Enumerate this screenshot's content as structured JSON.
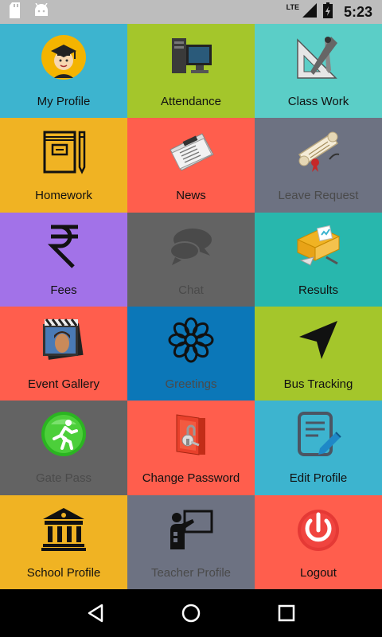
{
  "status_bar": {
    "time": "5:23",
    "network": "LTE",
    "icons": [
      "sd-card-icon",
      "android-icon",
      "signal-icon",
      "battery-icon"
    ]
  },
  "tiles": [
    {
      "label": "My Profile",
      "color": "#3db4cf",
      "icon": "graduate-avatar-icon"
    },
    {
      "label": "Attendance",
      "color": "#a4c62b",
      "icon": "computer-icon"
    },
    {
      "label": "Class Work",
      "color": "#5bcec7",
      "icon": "geometry-tools-icon"
    },
    {
      "label": "Homework",
      "color": "#f0b323",
      "icon": "notebook-icon"
    },
    {
      "label": "News",
      "color": "#ff5e4d",
      "icon": "newspaper-icon"
    },
    {
      "label": "Leave Request",
      "color": "#6d7282",
      "icon": "scroll-icon"
    },
    {
      "label": "Fees",
      "color": "#a272e8",
      "icon": "rupee-icon"
    },
    {
      "label": "Chat",
      "color": "#636363",
      "icon": "chat-bubbles-icon"
    },
    {
      "label": "Results",
      "color": "#28b7ad",
      "icon": "results-folder-icon"
    },
    {
      "label": "Event Gallery",
      "color": "#ff5e4d",
      "icon": "photo-gallery-icon"
    },
    {
      "label": "Greetings",
      "color": "#0b77b8",
      "icon": "flower-icon"
    },
    {
      "label": "Bus Tracking",
      "color": "#a4c62b",
      "icon": "navigation-arrow-icon"
    },
    {
      "label": "Gate Pass",
      "color": "#636363",
      "icon": "exit-runner-icon"
    },
    {
      "label": "Change Password",
      "color": "#ff5e4d",
      "icon": "locked-door-icon"
    },
    {
      "label": "Edit Profile",
      "color": "#3db4cf",
      "icon": "edit-document-icon"
    },
    {
      "label": "School Profile",
      "color": "#f0b323",
      "icon": "institution-icon"
    },
    {
      "label": "Teacher Profile",
      "color": "#6d7282",
      "icon": "teacher-board-icon"
    },
    {
      "label": "Logout",
      "color": "#ff5e4d",
      "icon": "power-icon"
    }
  ],
  "nav_bar": {
    "buttons": [
      "back-icon",
      "home-icon",
      "recents-icon"
    ]
  }
}
